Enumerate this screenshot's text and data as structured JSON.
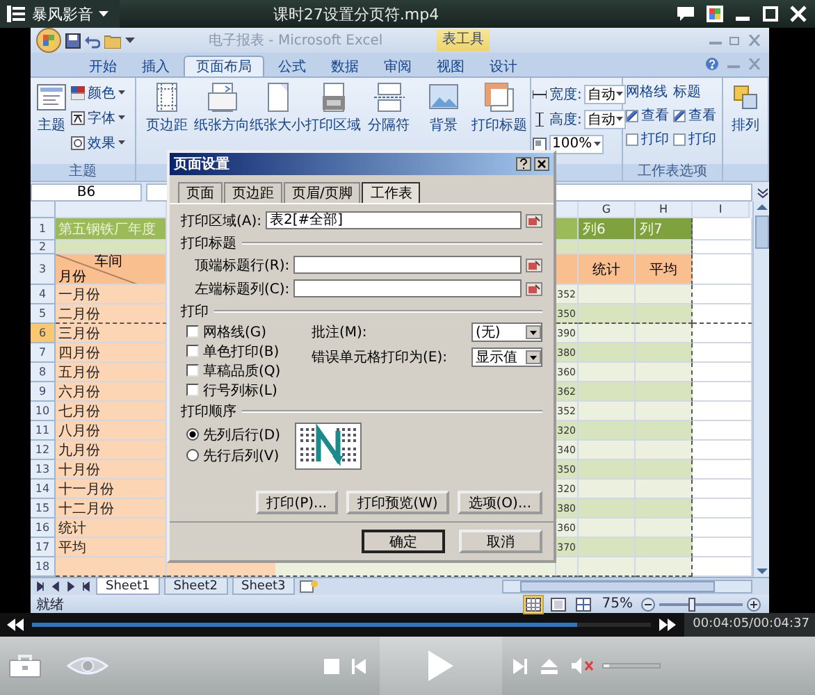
{
  "player": {
    "app_name": "暴风影音",
    "title": "课时27设置分页符.mp4"
  },
  "excel": {
    "title": "电子报表 - Microsoft Excel",
    "context_tab": "表工具",
    "tabs": [
      {
        "label": "开始",
        "selected": false
      },
      {
        "label": "插入",
        "selected": false
      },
      {
        "label": "页面布局",
        "selected": true
      },
      {
        "label": "公式",
        "selected": false
      },
      {
        "label": "数据",
        "selected": false
      },
      {
        "label": "审阅",
        "selected": false
      },
      {
        "label": "视图",
        "selected": false
      },
      {
        "label": "设计",
        "selected": false
      }
    ],
    "ribbon": {
      "theme": {
        "button": "主题",
        "items": [
          "颜色",
          "字体",
          "效果"
        ],
        "label": "主题"
      },
      "page_setup": [
        "页边距",
        "纸张方向",
        "纸张大小",
        "打印区域",
        "分隔符",
        "背景",
        "打印标题"
      ],
      "scale": [
        {
          "label": "宽度:",
          "value": "自动"
        },
        {
          "label": "高度:",
          "value": "自动"
        },
        {
          "value": "100%"
        }
      ],
      "sheet_options": {
        "groups": [
          {
            "title": "网格线",
            "options": [
              {
                "label": "查看",
                "checked": true
              },
              {
                "label": "打印",
                "checked": false
              }
            ]
          },
          {
            "title": "标题",
            "options": [
              {
                "label": "查看",
                "checked": true
              },
              {
                "label": "打印",
                "checked": false
              }
            ]
          }
        ],
        "label": "工作表选项"
      },
      "arrange": "排列"
    },
    "name_box": "B6",
    "column_headers": [
      "G",
      "H",
      "I"
    ],
    "rows": [
      {
        "number": "1",
        "kind": "title",
        "selected": false,
        "page_break": false,
        "a": "第五钢铁厂年度",
        "g": "列6",
        "h": "列7"
      },
      {
        "number": "2",
        "kind": "blank",
        "selected": false,
        "page_break": false
      },
      {
        "number": "3",
        "kind": "header",
        "selected": false,
        "page_break": false,
        "a_top": "车间",
        "a_bottom": "月份",
        "g": "统计",
        "h": "平均"
      },
      {
        "number": "4",
        "kind": "data",
        "selected": false,
        "page_break": false,
        "a": "一月份",
        "f": "352"
      },
      {
        "number": "5",
        "kind": "data",
        "selected": false,
        "page_break": true,
        "a": "二月份",
        "f": "350"
      },
      {
        "number": "6",
        "kind": "data",
        "selected": true,
        "page_break": false,
        "a": "三月份",
        "f": "390"
      },
      {
        "number": "7",
        "kind": "data",
        "selected": false,
        "page_break": false,
        "a": "四月份",
        "f": "380"
      },
      {
        "number": "8",
        "kind": "data",
        "selected": false,
        "page_break": false,
        "a": "五月份",
        "f": "360"
      },
      {
        "number": "9",
        "kind": "data",
        "selected": false,
        "page_break": false,
        "a": "六月份",
        "f": "362"
      },
      {
        "number": "10",
        "kind": "data",
        "selected": false,
        "page_break": false,
        "a": "七月份",
        "f": "352"
      },
      {
        "number": "11",
        "kind": "data",
        "selected": false,
        "page_break": false,
        "a": "八月份",
        "f": "320"
      },
      {
        "number": "12",
        "kind": "data",
        "selected": false,
        "page_break": false,
        "a": "九月份",
        "f": "340"
      },
      {
        "number": "13",
        "kind": "data",
        "selected": false,
        "page_break": false,
        "a": "十月份",
        "f": "350"
      },
      {
        "number": "14",
        "kind": "data",
        "selected": false,
        "page_break": false,
        "a": "十一月份",
        "f": "320"
      },
      {
        "number": "15",
        "kind": "data",
        "selected": false,
        "page_break": false,
        "a": "十二月份",
        "f": "380"
      },
      {
        "number": "16",
        "kind": "data",
        "selected": false,
        "page_break": false,
        "a": "统计",
        "f": "360"
      },
      {
        "number": "17",
        "kind": "data",
        "selected": false,
        "page_break": false,
        "a": "平均",
        "f": "370"
      },
      {
        "number": "18",
        "kind": "tail",
        "selected": false,
        "page_break": false
      }
    ],
    "sheet_tabs": [
      {
        "label": "Sheet1",
        "selected": true
      },
      {
        "label": "Sheet2",
        "selected": false
      },
      {
        "label": "Sheet3",
        "selected": false
      }
    ],
    "status": "就绪",
    "views": [
      {
        "kind": "normal",
        "selected": true
      },
      {
        "kind": "layout",
        "selected": false
      },
      {
        "kind": "break",
        "selected": false
      }
    ],
    "zoom": {
      "text": "75%",
      "level": 0.38
    }
  },
  "dialog": {
    "title": "页面设置",
    "tabs": [
      {
        "label": "页面",
        "selected": false
      },
      {
        "label": "页边距",
        "selected": false
      },
      {
        "label": "页眉/页脚",
        "selected": false
      },
      {
        "label": "工作表",
        "selected": true
      }
    ],
    "print_area": {
      "label": "打印区域(A):",
      "value": "表2[#全部]"
    },
    "print_titles": {
      "heading": "打印标题",
      "fields": [
        {
          "label": "顶端标题行(R):"
        },
        {
          "label": "左端标题列(C):"
        }
      ]
    },
    "print": {
      "heading": "打印",
      "checkboxes": [
        {
          "label": "网格线(G)",
          "checked": false
        },
        {
          "label": "单色打印(B)",
          "checked": false
        },
        {
          "label": "草稿品质(Q)",
          "checked": false
        },
        {
          "label": "行号列标(L)",
          "checked": false
        }
      ],
      "selects": [
        {
          "label": "批注(M):",
          "value": "(无)"
        },
        {
          "label": "错误单元格打印为(E):",
          "value": "显示值"
        }
      ]
    },
    "order": {
      "heading": "打印顺序",
      "options": [
        {
          "label": "先列后行(D)",
          "selected": true
        },
        {
          "label": "先行后列(V)",
          "selected": false
        }
      ]
    },
    "buttons": [
      "打印(P)...",
      "打印预览(W)",
      "选项(O)..."
    ],
    "footer_buttons": [
      "确定",
      "取消"
    ]
  },
  "playback": {
    "level": 0.88,
    "time": "00:04:05/00:04:37"
  },
  "volume": {
    "muted": true,
    "level": 0.1
  }
}
